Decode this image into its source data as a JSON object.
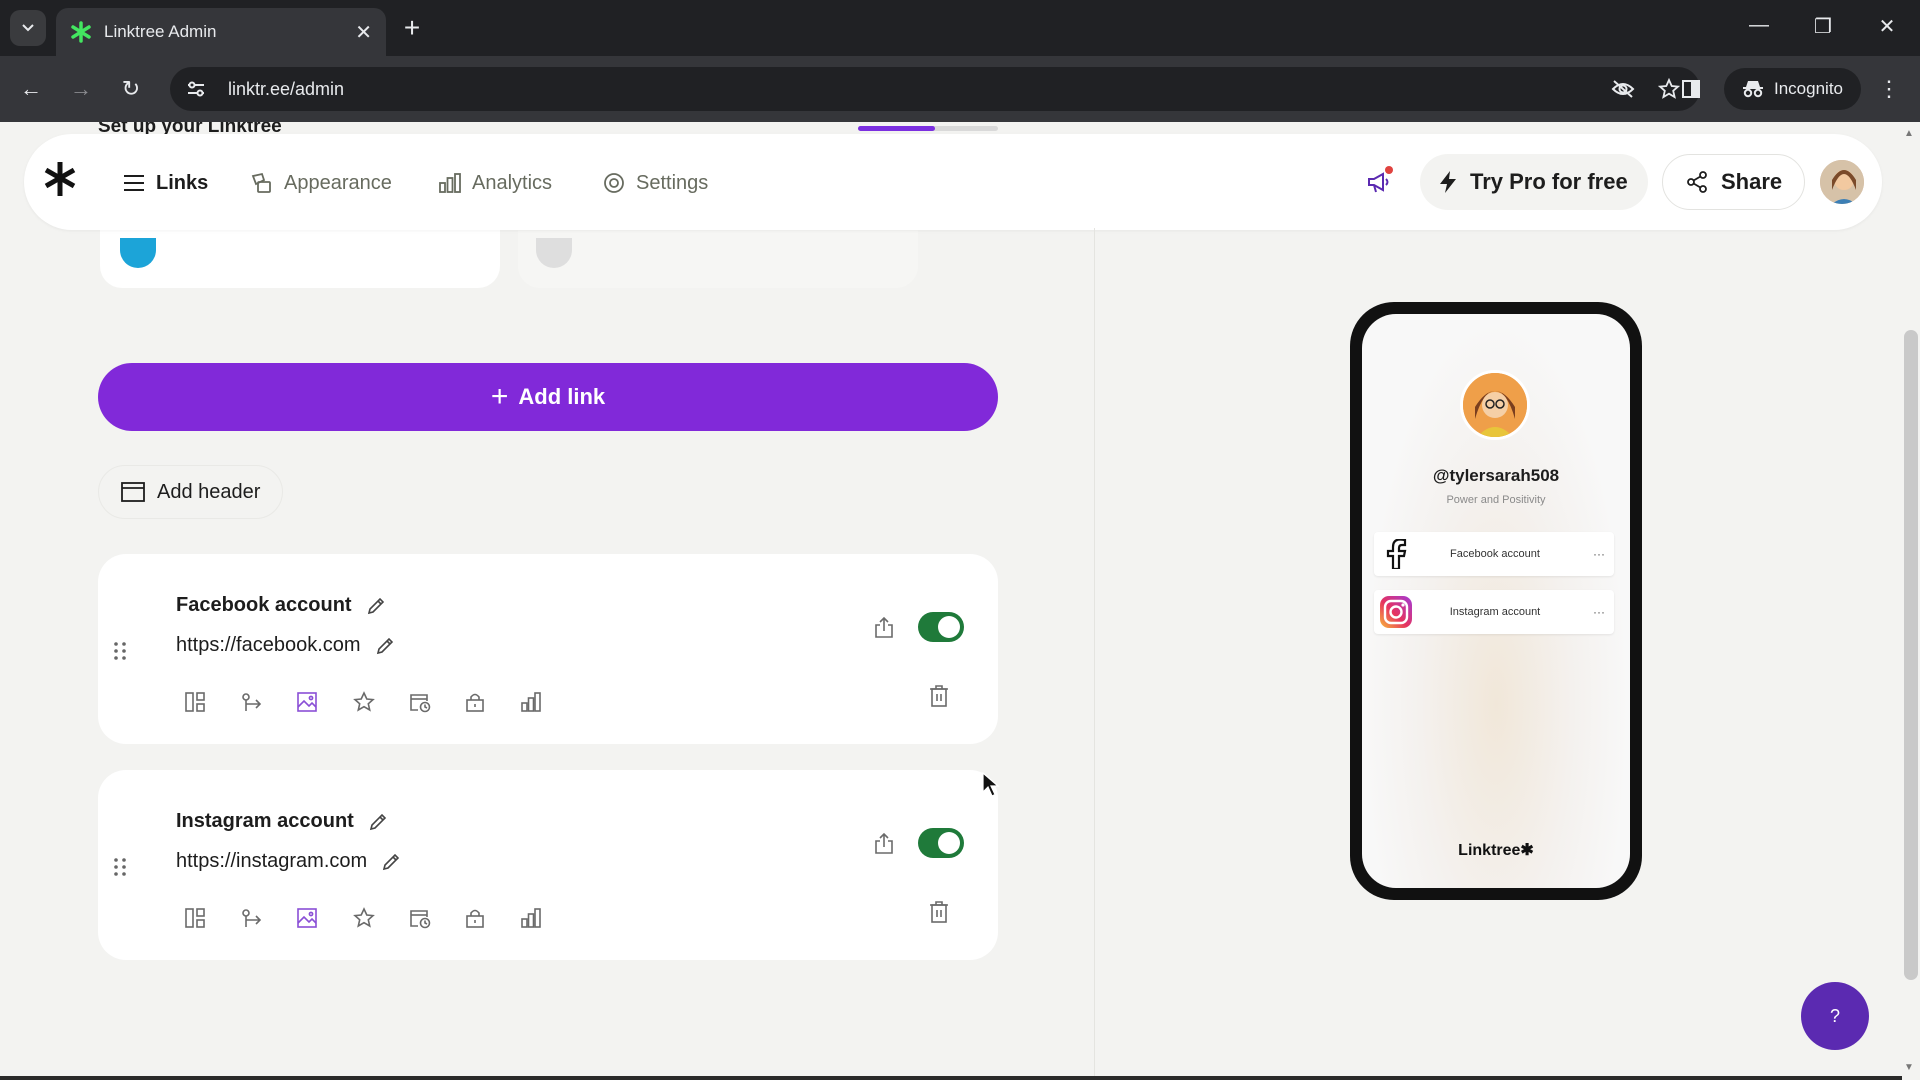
{
  "browser": {
    "tab_title": "Linktree Admin",
    "url": "linktr.ee/admin",
    "incognito_label": "Incognito"
  },
  "setup": {
    "title": "Set up your Linktree",
    "progress": 0.55
  },
  "nav": {
    "links": "Links",
    "appearance": "Appearance",
    "analytics": "Analytics",
    "settings": "Settings",
    "try_pro": "Try Pro for free",
    "share": "Share"
  },
  "actions": {
    "add_link": "Add link",
    "add_header": "Add header"
  },
  "links": [
    {
      "title": "Facebook account",
      "url": "https://facebook.com",
      "enabled": true
    },
    {
      "title": "Instagram account",
      "url": "https://instagram.com",
      "enabled": true
    }
  ],
  "preview": {
    "username": "@tylersarah508",
    "bio": "Power and Positivity",
    "links": [
      "Facebook account",
      "Instagram account"
    ],
    "footer": "Linktree✱"
  },
  "help": {
    "label": "?"
  },
  "colors": {
    "accent": "#8129d9",
    "toggle_on": "#1f7a3a",
    "help": "#5b2ab1"
  },
  "icons": [
    "asterisk-logo-icon",
    "links-icon",
    "appearance-icon",
    "analytics-icon",
    "settings-icon",
    "megaphone-icon",
    "bolt-icon",
    "share-icon",
    "plus-icon",
    "header-icon",
    "pencil-icon",
    "drag-handle-icon",
    "layout-icon",
    "redirect-icon",
    "thumbnail-icon",
    "star-icon",
    "schedule-icon",
    "lock-icon",
    "stats-icon",
    "export-icon",
    "trash-icon",
    "facebook-icon",
    "instagram-icon"
  ]
}
